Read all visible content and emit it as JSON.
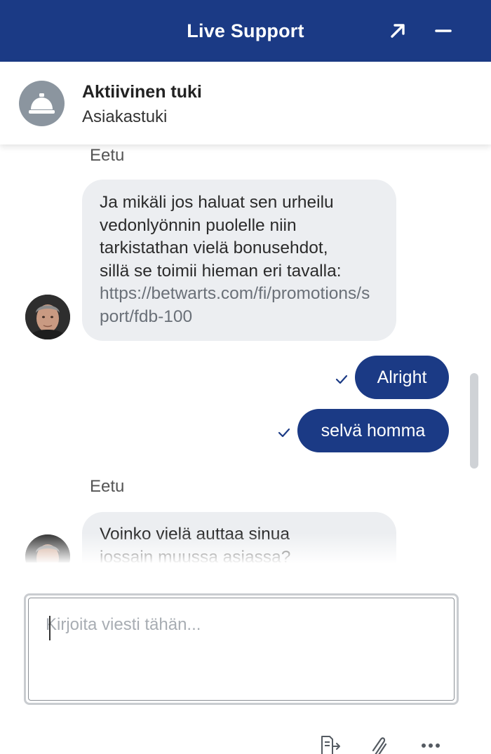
{
  "header": {
    "title": "Live Support",
    "expand_icon": "arrow-expand-icon",
    "minimize_icon": "minimize-icon",
    "background": "#1b3a85"
  },
  "agent": {
    "name": "Aktiivinen tuki",
    "role": "Asiakastuki",
    "icon": "service-bell-icon"
  },
  "messages": [
    {
      "direction": "incoming",
      "sender": "Eetu",
      "lines": [
        "Ja mikäli jos haluat sen urheilu",
        "vedonlyönnin puolelle niin",
        "tarkistathan vielä bonusehdot,",
        "sillä se toimii hieman eri tavalla:"
      ],
      "link": "https://betwarts.com/fi/promotions/sport/fdb-100"
    },
    {
      "direction": "outgoing",
      "text": "Alright",
      "status_icon": "check-icon"
    },
    {
      "direction": "outgoing",
      "text": "selvä homma",
      "status_icon": "check-icon"
    },
    {
      "direction": "incoming",
      "sender": "Eetu",
      "lines": [
        "Voinko vielä auttaa sinua",
        "jossain muussa asiassa?"
      ]
    }
  ],
  "composer": {
    "placeholder": "Kirjoita viesti tähän...",
    "value": ""
  },
  "toolbar": {
    "transcript_icon": "transcript-icon",
    "attach_icon": "paperclip-icon",
    "more_icon": "more-options-icon"
  },
  "colors": {
    "accent": "#1b3a85",
    "incoming_bubble": "#eceef1",
    "agent_icon_bg": "#8b959f"
  }
}
